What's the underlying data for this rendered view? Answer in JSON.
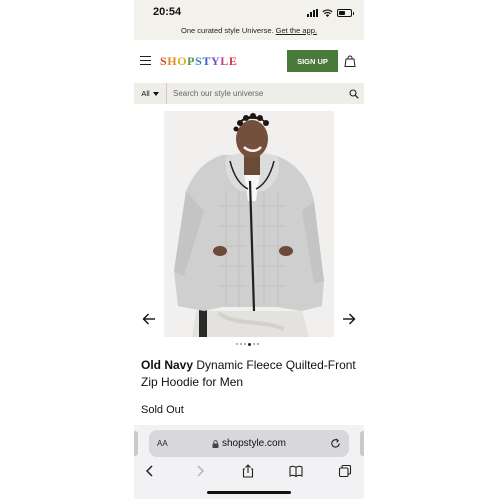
{
  "status_bar": {
    "time": "20:54"
  },
  "promo": {
    "text": "One curated style Universe.",
    "link": "Get the app."
  },
  "header": {
    "logo_letters": [
      {
        "char": "S",
        "color": "#e0452b"
      },
      {
        "char": "H",
        "color": "#e08a1f"
      },
      {
        "char": "O",
        "color": "#d6b21e"
      },
      {
        "char": "P",
        "color": "#4a9a3c"
      },
      {
        "char": "S",
        "color": "#2a8fb5"
      },
      {
        "char": "T",
        "color": "#3a5fc2"
      },
      {
        "char": "Y",
        "color": "#7a4bbf"
      },
      {
        "char": "L",
        "color": "#b8409a"
      },
      {
        "char": "E",
        "color": "#d8344f"
      }
    ],
    "signup_label": "SIGN UP"
  },
  "search": {
    "category": "All",
    "placeholder": "Search our style universe"
  },
  "product": {
    "brand": "Old Navy",
    "name": " Dynamic Fleece Quilted-Front Zip Hoodie for Men",
    "status": "Sold Out",
    "carousel": {
      "count": 6,
      "active_index": 3
    }
  },
  "browser": {
    "text_size_label": "AA",
    "url": "shopstyle.com"
  },
  "colors": {
    "accent": "#4a7a3c",
    "promo_bg": "#f3f1ec"
  }
}
